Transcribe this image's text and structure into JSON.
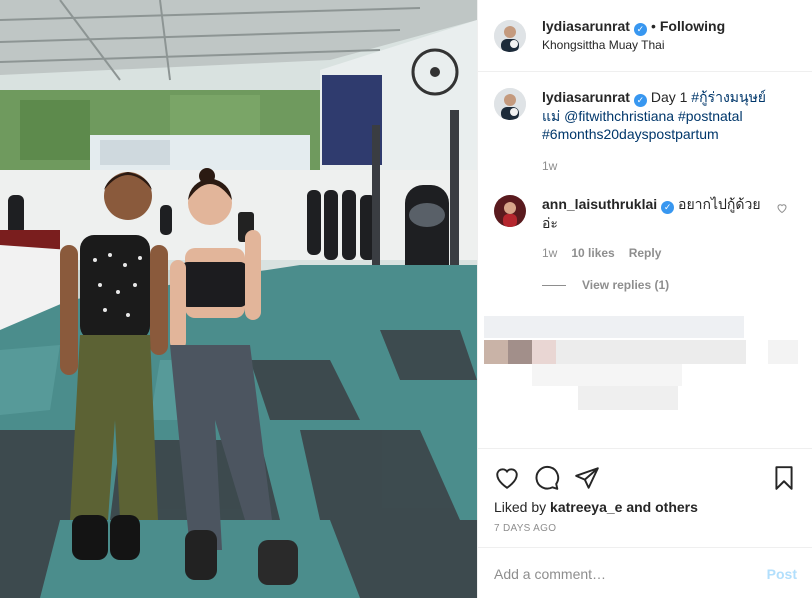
{
  "post": {
    "author": "lydiasarunrat",
    "follow_status": "Following",
    "location": "Khongsittha Muay Thai",
    "caption_prefix": "Day 1",
    "caption_tags": [
      "#กู้ร่างมนุษย์แม่",
      "@fitwithchristiana",
      "#postnatal",
      "#6months20dayspostpartum"
    ],
    "caption_time": "1w",
    "liked_by_user": "katreeya_e",
    "liked_by_prefix": "Liked by",
    "liked_by_suffix": "and others",
    "posted_ago": "7 DAYS AGO"
  },
  "comments": [
    {
      "user": "ann_laisuthruklai",
      "text": "อยากไปกู้ด้วยอ่ะ",
      "time": "1w",
      "likes": "10 likes",
      "reply_label": "Reply",
      "view_replies": "View replies (1)"
    }
  ],
  "composer": {
    "placeholder": "Add a comment…",
    "post_label": "Post"
  },
  "colors": {
    "verified": "#3897f0",
    "link": "#00376b",
    "post_disabled": "#b2dffc"
  },
  "icons": [
    "verified-badge-icon",
    "heart-icon",
    "comment-icon",
    "share-icon",
    "bookmark-icon"
  ]
}
